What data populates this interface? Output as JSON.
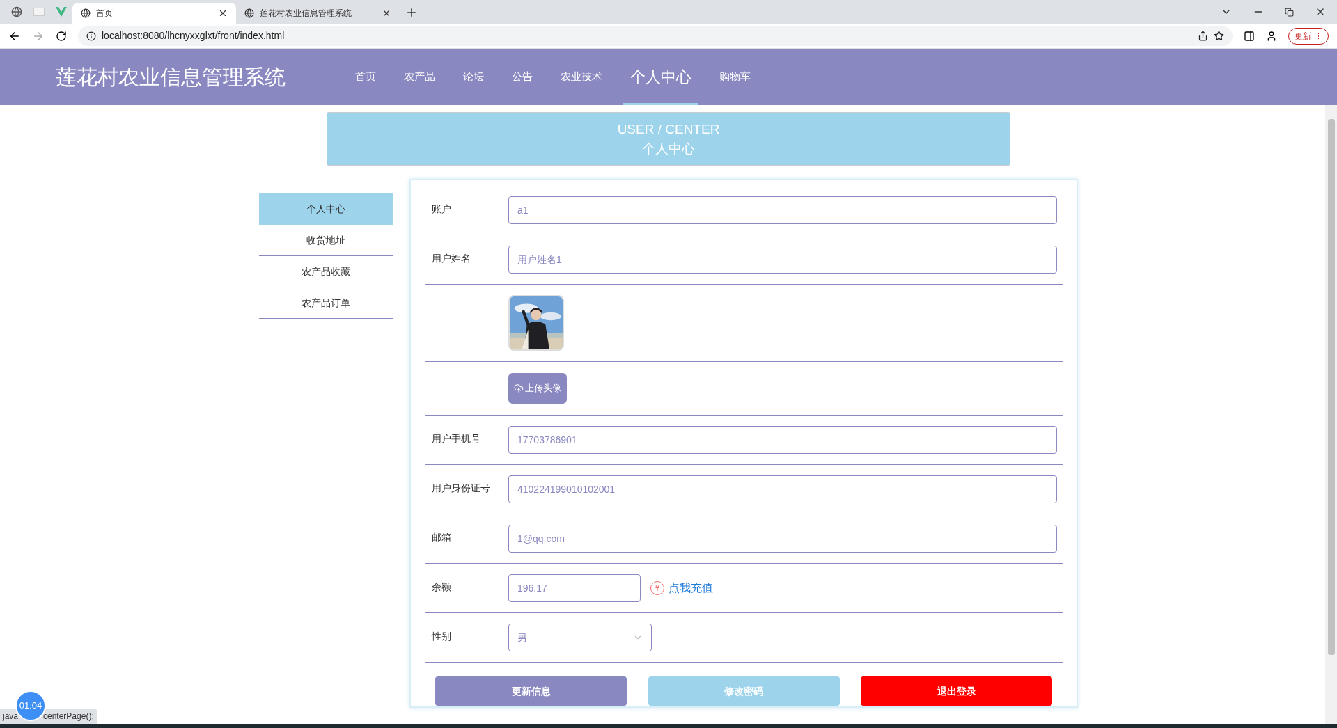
{
  "browser": {
    "tabs": [
      {
        "title": "首页",
        "selected": true
      },
      {
        "title": "莲花村农业信息管理系统",
        "selected": false
      }
    ],
    "url": "localhost:8080/lhcnyxxglxt/front/index.html",
    "update_label": "更新"
  },
  "header": {
    "title": "莲花村农业信息管理系统",
    "nav": [
      {
        "label": "首页",
        "selected": false
      },
      {
        "label": "农产品",
        "selected": false
      },
      {
        "label": "论坛",
        "selected": false
      },
      {
        "label": "公告",
        "selected": false
      },
      {
        "label": "农业技术",
        "selected": false
      },
      {
        "label": "个人中心",
        "selected": true
      },
      {
        "label": "购物车",
        "selected": false
      }
    ]
  },
  "banner": {
    "title_en": "USER / CENTER",
    "title_cn": "个人中心"
  },
  "sidebar": [
    {
      "label": "个人中心",
      "selected": true
    },
    {
      "label": "收货地址",
      "selected": false
    },
    {
      "label": "农产品收藏",
      "selected": false
    },
    {
      "label": "农产品订单",
      "selected": false
    }
  ],
  "form": {
    "rows": [
      {
        "kind": "text",
        "label": "账户",
        "value": "a1"
      },
      {
        "kind": "text",
        "label": "用户姓名",
        "value": "用户姓名1"
      },
      {
        "kind": "avatar"
      },
      {
        "kind": "upload",
        "button": "上传头像"
      },
      {
        "kind": "text",
        "label": "用户手机号",
        "value": "17703786901"
      },
      {
        "kind": "text",
        "label": "用户身份证号",
        "value": "410224199010102001"
      },
      {
        "kind": "text",
        "label": "邮箱",
        "value": "1@qq.com"
      },
      {
        "kind": "balance",
        "label": "余额",
        "value": "196.17",
        "currency": "¥",
        "link": "点我充值"
      },
      {
        "kind": "select",
        "label": "性别",
        "value": "男"
      }
    ],
    "buttons": [
      {
        "label": "更新信息",
        "kind": "primary"
      },
      {
        "label": "修改密码",
        "kind": "secondary"
      },
      {
        "label": "退出登录",
        "kind": "danger"
      }
    ]
  },
  "status_bar": {
    "text_start": "java",
    "text_end": "centerPage();"
  },
  "timer": "01:04"
}
